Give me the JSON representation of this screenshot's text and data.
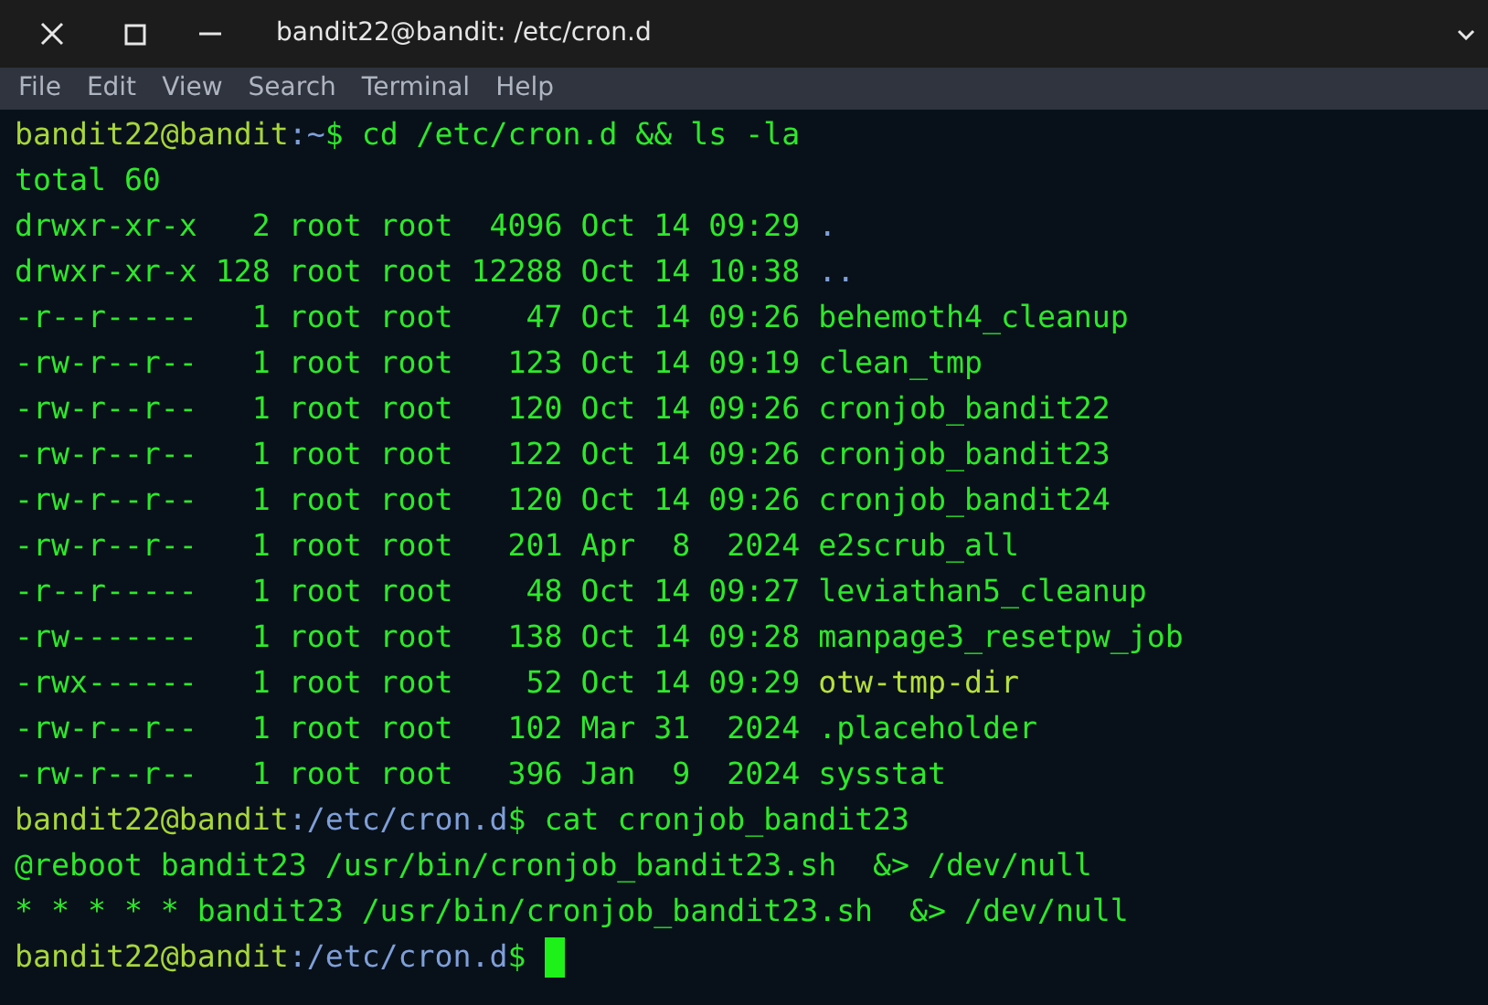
{
  "window": {
    "title": "bandit22@bandit: /etc/cron.d"
  },
  "menu": [
    "File",
    "Edit",
    "View",
    "Search",
    "Terminal",
    "Help"
  ],
  "lines": [
    {
      "segments": [
        {
          "kind": "host",
          "text": "bandit22@bandit"
        },
        {
          "kind": "path",
          "text": ":~"
        },
        {
          "kind": "output",
          "text": "$ cd /etc/cron.d && ls -la"
        }
      ]
    },
    {
      "segments": [
        {
          "kind": "output",
          "text": "total 60"
        }
      ]
    },
    {
      "segments": [
        {
          "kind": "output",
          "text": "drwxr-xr-x   2 root root  4096 Oct 14 09:29 "
        },
        {
          "kind": "dir",
          "text": "."
        }
      ]
    },
    {
      "segments": [
        {
          "kind": "output",
          "text": "drwxr-xr-x 128 root root 12288 Oct 14 10:38 "
        },
        {
          "kind": "dir",
          "text": ".."
        }
      ]
    },
    {
      "segments": [
        {
          "kind": "output",
          "text": "-r--r-----   1 root root    47 Oct 14 09:26 behemoth4_cleanup"
        }
      ]
    },
    {
      "segments": [
        {
          "kind": "output",
          "text": "-rw-r--r--   1 root root   123 Oct 14 09:19 clean_tmp"
        }
      ]
    },
    {
      "segments": [
        {
          "kind": "output",
          "text": "-rw-r--r--   1 root root   120 Oct 14 09:26 cronjob_bandit22"
        }
      ]
    },
    {
      "segments": [
        {
          "kind": "output",
          "text": "-rw-r--r--   1 root root   122 Oct 14 09:26 cronjob_bandit23"
        }
      ]
    },
    {
      "segments": [
        {
          "kind": "output",
          "text": "-rw-r--r--   1 root root   120 Oct 14 09:26 cronjob_bandit24"
        }
      ]
    },
    {
      "segments": [
        {
          "kind": "output",
          "text": "-rw-r--r--   1 root root   201 Apr  8  2024 e2scrub_all"
        }
      ]
    },
    {
      "segments": [
        {
          "kind": "output",
          "text": "-r--r-----   1 root root    48 Oct 14 09:27 leviathan5_cleanup"
        }
      ]
    },
    {
      "segments": [
        {
          "kind": "output",
          "text": "-rw-------   1 root root   138 Oct 14 09:28 manpage3_resetpw_job"
        }
      ]
    },
    {
      "segments": [
        {
          "kind": "output",
          "text": "-rwx------   1 root root    52 Oct 14 09:29 "
        },
        {
          "kind": "exec",
          "text": "otw-tmp-dir"
        }
      ]
    },
    {
      "segments": [
        {
          "kind": "output",
          "text": "-rw-r--r--   1 root root   102 Mar 31  2024 .placeholder"
        }
      ]
    },
    {
      "segments": [
        {
          "kind": "output",
          "text": "-rw-r--r--   1 root root   396 Jan  9  2024 sysstat"
        }
      ]
    },
    {
      "segments": [
        {
          "kind": "host",
          "text": "bandit22@bandit"
        },
        {
          "kind": "path",
          "text": ":/etc/cron.d"
        },
        {
          "kind": "output",
          "text": "$ cat cronjob_bandit23"
        }
      ]
    },
    {
      "segments": [
        {
          "kind": "output",
          "text": "@reboot bandit23 /usr/bin/cronjob_bandit23.sh  &> /dev/null"
        }
      ]
    },
    {
      "segments": [
        {
          "kind": "output",
          "text": "* * * * * bandit23 /usr/bin/cronjob_bandit23.sh  &> /dev/null"
        }
      ]
    },
    {
      "segments": [
        {
          "kind": "host",
          "text": "bandit22@bandit"
        },
        {
          "kind": "path",
          "text": ":/etc/cron.d"
        },
        {
          "kind": "output",
          "text": "$ "
        }
      ],
      "cursor": true
    }
  ]
}
